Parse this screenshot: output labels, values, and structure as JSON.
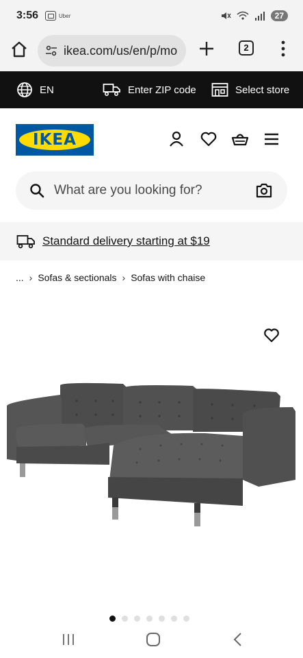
{
  "status_bar": {
    "time": "3:56",
    "app_label": "Uber",
    "battery": "27"
  },
  "browser": {
    "url": "ikea.com/us/en/p/mo",
    "tab_count": "2"
  },
  "top_strip": {
    "language": "EN",
    "zip_label": "Enter ZIP code",
    "store_label": "Select store"
  },
  "header": {
    "logo_text": "IKEA",
    "brand_colors": {
      "blue": "#0058a3",
      "yellow": "#ffdb00"
    }
  },
  "search": {
    "placeholder": "What are you looking for?"
  },
  "delivery": {
    "text": "Standard delivery starting at $19"
  },
  "breadcrumb": {
    "ellipsis": "...",
    "items": [
      "Sofas & sectionals",
      "Sofas with chaise"
    ]
  },
  "carousel": {
    "dot_count": 7,
    "active_index": 0
  }
}
